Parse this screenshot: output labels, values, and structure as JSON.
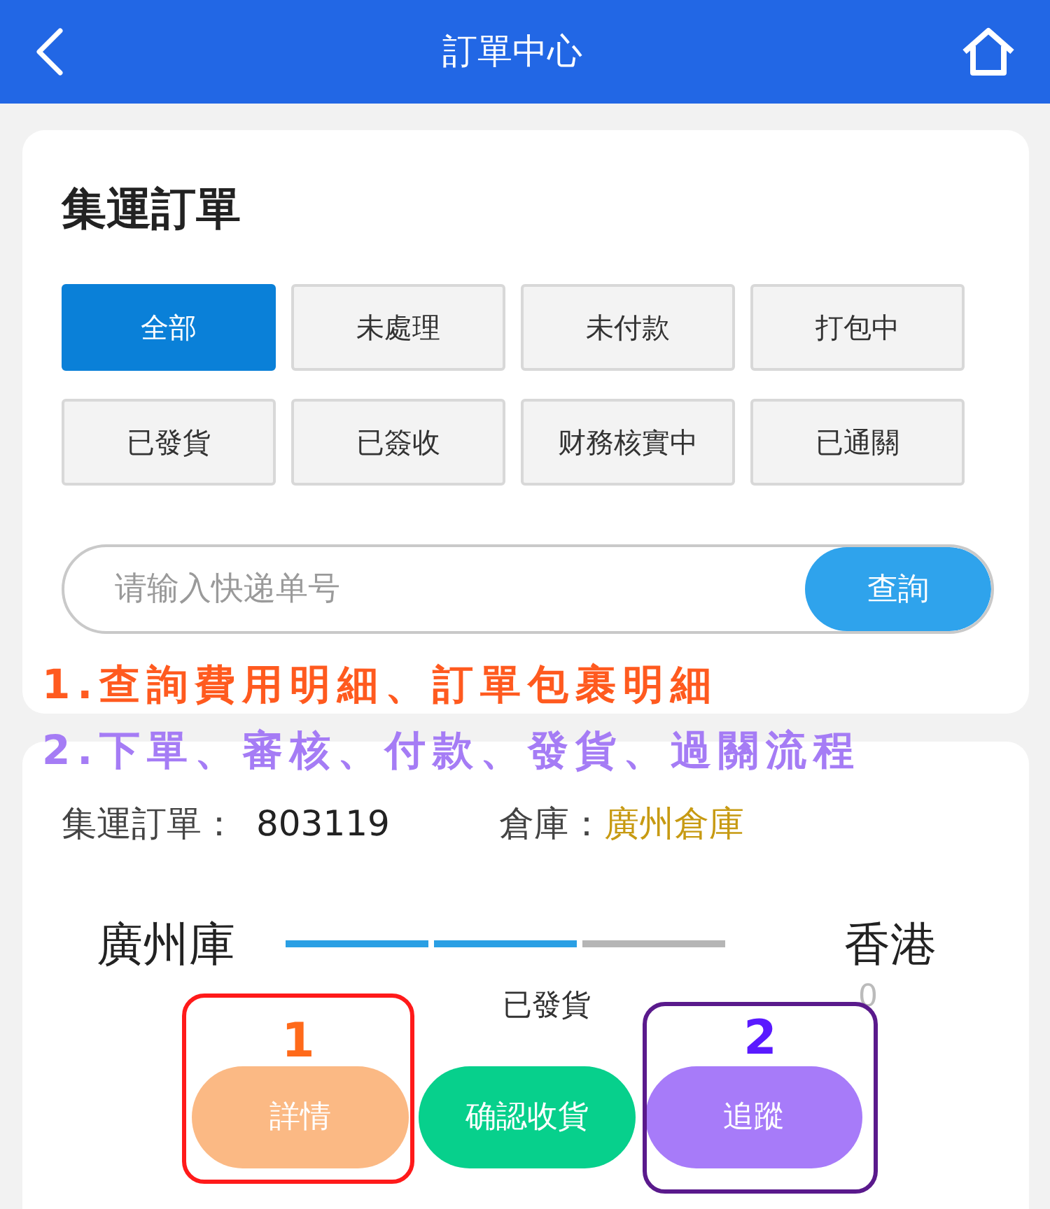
{
  "header": {
    "title": "訂單中心"
  },
  "orders_card": {
    "title": "集運訂單",
    "filters": [
      {
        "label": "全部",
        "selected": true
      },
      {
        "label": "未處理",
        "selected": false
      },
      {
        "label": "未付款",
        "selected": false
      },
      {
        "label": "打包中",
        "selected": false
      },
      {
        "label": "已發貨",
        "selected": false
      },
      {
        "label": "已簽收",
        "selected": false
      },
      {
        "label": "财務核實中",
        "selected": false
      },
      {
        "label": "已通關",
        "selected": false
      }
    ],
    "search": {
      "placeholder": "请输入快递单号",
      "button": "查詢"
    }
  },
  "annotations": [
    {
      "text": "1.查詢費用明細、訂單包裹明細",
      "color": "#ff5a1f"
    },
    {
      "text": "2.下單、審核、付款、發貨、過關流程",
      "color": "#a57cf5"
    }
  ],
  "order": {
    "label": "集運訂單：",
    "number": "803119",
    "warehouse_label": "倉庫：",
    "warehouse": "廣州倉庫",
    "origin": "廣州庫",
    "destination": "香港",
    "progress": [
      {
        "done": true
      },
      {
        "done": true
      },
      {
        "done": false
      }
    ],
    "status": "已發貨",
    "count": "0",
    "buttons": [
      {
        "label": "詳情",
        "color": "#fbb984"
      },
      {
        "label": "确認收貨",
        "color": "#07d08c"
      },
      {
        "label": "追蹤",
        "color": "#a77bf9"
      }
    ]
  },
  "callouts": [
    {
      "color": "#ff1a1a",
      "number": {
        "text": "1",
        "color": "#ff6a1a"
      }
    },
    {
      "color": "#5a1a8c",
      "number": {
        "text": "2",
        "color": "#5a1aff"
      }
    }
  ]
}
